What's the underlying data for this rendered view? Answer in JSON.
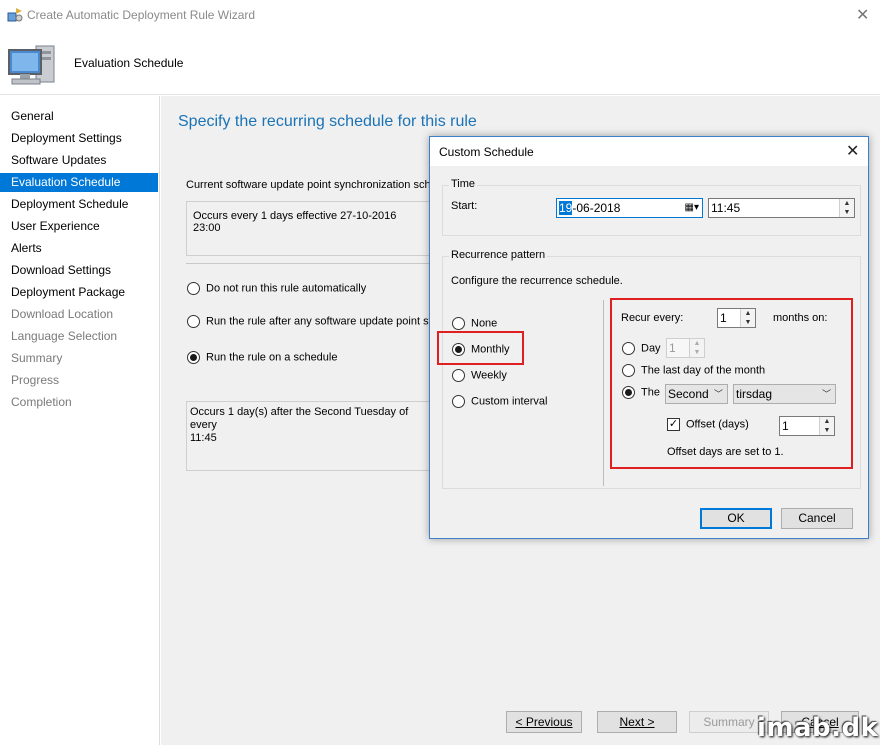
{
  "window": {
    "title": "Create Automatic Deployment Rule Wizard",
    "header_title": "Evaluation Schedule"
  },
  "sidebar": {
    "items": [
      {
        "label": "General",
        "state": "normal"
      },
      {
        "label": "Deployment Settings",
        "state": "normal"
      },
      {
        "label": "Software Updates",
        "state": "normal"
      },
      {
        "label": "Evaluation Schedule",
        "state": "active"
      },
      {
        "label": "Deployment Schedule",
        "state": "normal"
      },
      {
        "label": "User Experience",
        "state": "normal"
      },
      {
        "label": "Alerts",
        "state": "normal"
      },
      {
        "label": "Download Settings",
        "state": "normal"
      },
      {
        "label": "Deployment Package",
        "state": "normal"
      },
      {
        "label": "Download Location",
        "state": "disabled"
      },
      {
        "label": "Language Selection",
        "state": "disabled"
      },
      {
        "label": "Summary",
        "state": "disabled"
      },
      {
        "label": "Progress",
        "state": "disabled"
      },
      {
        "label": "Completion",
        "state": "disabled"
      }
    ]
  },
  "main": {
    "heading": "Specify the recurring schedule for this rule",
    "sync_label": "Current software update point synchronization sche",
    "sync_value": "Occurs every 1 days effective 27-10-2016 23:00",
    "options": [
      {
        "label": "Do not run this rule automatically",
        "checked": false
      },
      {
        "label": "Run the rule after any software update point sy",
        "checked": false
      },
      {
        "label": "Run the rule on a schedule",
        "checked": true
      }
    ],
    "schedule_description": "Occurs 1 day(s) after the Second Tuesday of every\n11:45"
  },
  "wizard_buttons": {
    "previous": "< Previous",
    "next": "Next >",
    "summary": "Summary",
    "cancel": "Cancel"
  },
  "dialog": {
    "title": "Custom Schedule",
    "time_group": "Time",
    "start_label": "Start:",
    "date_day": "19",
    "date_rest": "-06-2018",
    "time_value": "11:45",
    "recurrence_group": "Recurrence pattern",
    "configure_text": "Configure the recurrence schedule.",
    "patterns": [
      {
        "label": "None",
        "checked": false
      },
      {
        "label": "Monthly",
        "checked": true
      },
      {
        "label": "Weekly",
        "checked": false
      },
      {
        "label": "Custom interval",
        "checked": false
      }
    ],
    "recur_every_label": "Recur every:",
    "recur_every_value": "1",
    "months_on_label": "months on:",
    "day_label": "Day",
    "day_value": "1",
    "last_day_label": "The last day of the month",
    "the_label": "The",
    "week_select": "Second",
    "weekday_select": "tirsdag",
    "offset_label": "Offset (days)",
    "offset_checked": true,
    "offset_value": "1",
    "offset_info": "Offset days are set to 1.",
    "ok": "OK",
    "cancel": "Cancel"
  },
  "watermark": "imab.dk",
  "colors": {
    "accent": "#0078d7",
    "heading": "#1a73b6",
    "highlight_box": "#e02020"
  }
}
